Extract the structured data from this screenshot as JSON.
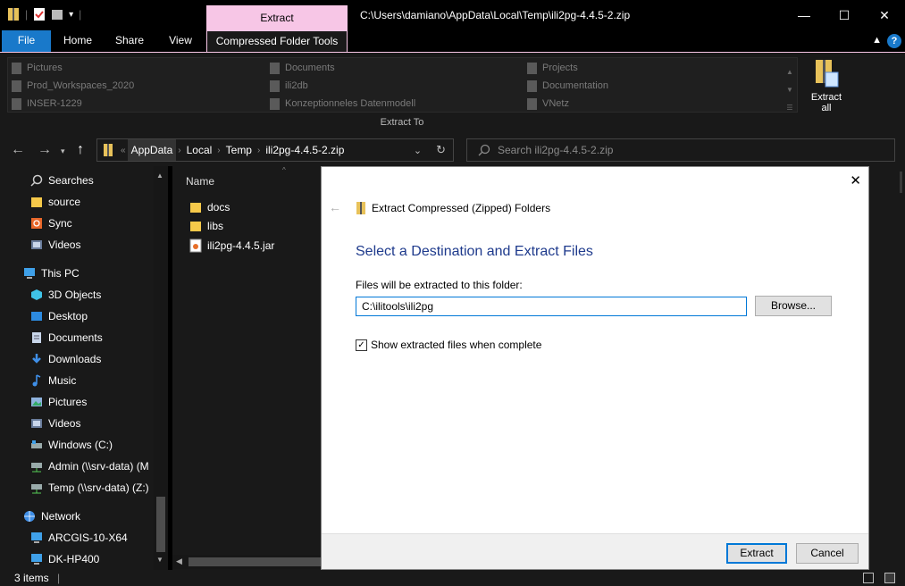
{
  "titlebar": {
    "context_tab": "Extract",
    "window_title": "C:\\Users\\damiano\\AppData\\Local\\Temp\\ili2pg-4.4.5-2.zip",
    "minimize": "—",
    "maximize": "☐",
    "close": "✕"
  },
  "ribbon_tabs": {
    "file": "File",
    "home": "Home",
    "share": "Share",
    "view": "View",
    "compressed": "Compressed Folder Tools",
    "help": "?"
  },
  "ribbon": {
    "gallery": [
      {
        "label": "Pictures"
      },
      {
        "label": "Prod_Workspaces_2020"
      },
      {
        "label": "INSER-1229"
      },
      {
        "label": "Documents"
      },
      {
        "label": "ili2db"
      },
      {
        "label": "Konzeptionneles Datenmodell"
      },
      {
        "label": "Projects"
      },
      {
        "label": "Documentation"
      },
      {
        "label": "VNetz"
      }
    ],
    "extract_all_line1": "Extract",
    "extract_all_line2": "all",
    "group_label": "Extract To"
  },
  "address": {
    "crumbs": [
      "AppData",
      "Local",
      "Temp",
      "ili2pg-4.4.5-2.zip"
    ],
    "search_placeholder": "Search ili2pg-4.4.5-2.zip"
  },
  "nav": {
    "items": [
      {
        "label": "Searches",
        "icon": "search-icon"
      },
      {
        "label": "source",
        "icon": "folder-icon"
      },
      {
        "label": "Sync",
        "icon": "sync-folder-icon"
      },
      {
        "label": "Videos",
        "icon": "videos-icon"
      },
      {
        "label": "This PC",
        "icon": "computer-icon"
      },
      {
        "label": "3D Objects",
        "icon": "3d-objects-icon"
      },
      {
        "label": "Desktop",
        "icon": "desktop-icon"
      },
      {
        "label": "Documents",
        "icon": "documents-icon"
      },
      {
        "label": "Downloads",
        "icon": "downloads-icon"
      },
      {
        "label": "Music",
        "icon": "music-icon"
      },
      {
        "label": "Pictures",
        "icon": "pictures-icon"
      },
      {
        "label": "Videos",
        "icon": "videos-icon"
      },
      {
        "label": "Windows  (C:)",
        "icon": "drive-icon"
      },
      {
        "label": "Admin (\\\\srv-data) (M",
        "icon": "network-drive-icon"
      },
      {
        "label": "Temp (\\\\srv-data) (Z:)",
        "icon": "network-drive-icon"
      },
      {
        "label": "Network",
        "icon": "network-icon"
      },
      {
        "label": "ARCGIS-10-X64",
        "icon": "computer-icon"
      },
      {
        "label": "DK-HP400",
        "icon": "computer-icon"
      }
    ]
  },
  "content": {
    "column_name": "Name",
    "files": [
      {
        "name": "docs",
        "icon": "folder-icon"
      },
      {
        "name": "libs",
        "icon": "folder-icon"
      },
      {
        "name": "ili2pg-4.4.5.jar",
        "icon": "java-jar-icon"
      }
    ]
  },
  "status": {
    "items_count": "3 items"
  },
  "dialog": {
    "title": "Extract Compressed (Zipped) Folders",
    "heading": "Select a Destination and Extract Files",
    "folder_label": "Files will be extracted to this folder:",
    "folder_value": "C:\\ilitools\\ili2pg",
    "browse_label": "Browse...",
    "show_files_label": "Show extracted files when complete",
    "show_files_checked": true,
    "extract_label": "Extract",
    "cancel_label": "Cancel"
  }
}
